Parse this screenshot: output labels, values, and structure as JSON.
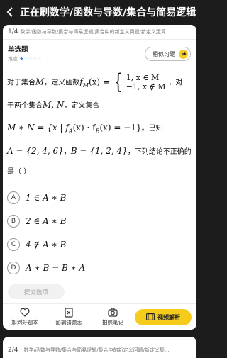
{
  "header": {
    "title": "正在刷数学/函数与导数/集合与简易逻辑"
  },
  "question": {
    "index": "1/4",
    "breadcrumb": "数学/函数与导数/集合与简易逻辑/集合中的新定义问题/新定义运算",
    "type": "单选题",
    "difficulty_label": "难度",
    "difficulty_stars": 1,
    "difficulty_max": 5,
    "similar_button": "相似习题",
    "stem": {
      "line1_prefix": "对于集合",
      "line1_m": "M",
      "line1_mid": "，定义函数",
      "line1_f": "f",
      "line1_sub": "M",
      "line1_arg": "(x) =",
      "case1": "1, x ∈ M",
      "case2": "−1, x ∉ M",
      "line1_suffix": "，对",
      "line2_prefix": "于两个集合",
      "line2_sets": "M, N",
      "line2_suffix": "，定义集合",
      "line3_math": "M ∗ N = {x | f",
      "line3_math_b": "(x) · f",
      "line3_math_c": "(x) = −1}",
      "line3_suffix": "。已知",
      "line4_math_a": "A = {2, 4, 6}",
      "line4_sep": "，",
      "line4_math_b": "B = {1, 2, 4}",
      "line4_suffix": "，下列结论不正确的",
      "line5": "是（    ）"
    },
    "options": [
      {
        "letter": "A",
        "expr": "1 ∈ A ∗ B"
      },
      {
        "letter": "B",
        "expr": "2 ∈ A ∗ B"
      },
      {
        "letter": "C",
        "expr": "4 ∉ A ∗ B"
      },
      {
        "letter": "D",
        "expr": "A ∗ B = B ∗ A"
      }
    ],
    "submit_label": "提交选项"
  },
  "toolbar": {
    "favorite": "加到好题本",
    "wrongbook": "加到错题本",
    "photo_note": "拍照笔记",
    "video": "视频解析"
  },
  "next_question": {
    "index": "2/4",
    "breadcrumb": "数学/函数与导数/集合与简易逻辑/集合中的新定义问题/新定义集..."
  },
  "colors": {
    "accent": "#f6cc1c",
    "star": "#2b7de9",
    "background": "#1c1c1c"
  }
}
